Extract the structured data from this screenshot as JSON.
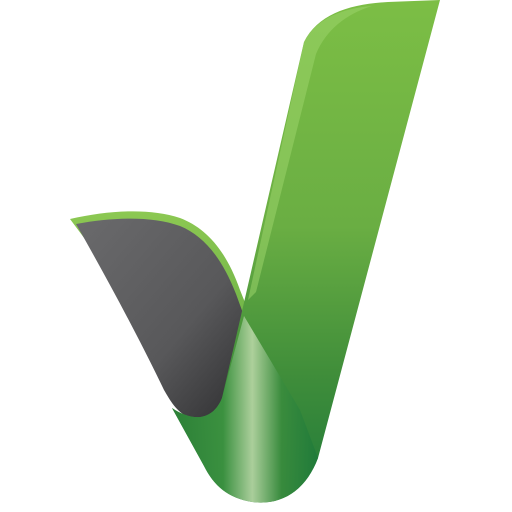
{
  "icon": {
    "name": "checkmark-icon",
    "colors": {
      "background": "#ffffff",
      "green_light": "#7cbe45",
      "green_mid": "#4c9a3c",
      "green_dark": "#1f7a3a",
      "gray_face": "#606062",
      "gray_dark": "#2f2f31",
      "highlight": "#b9d7a6"
    }
  }
}
